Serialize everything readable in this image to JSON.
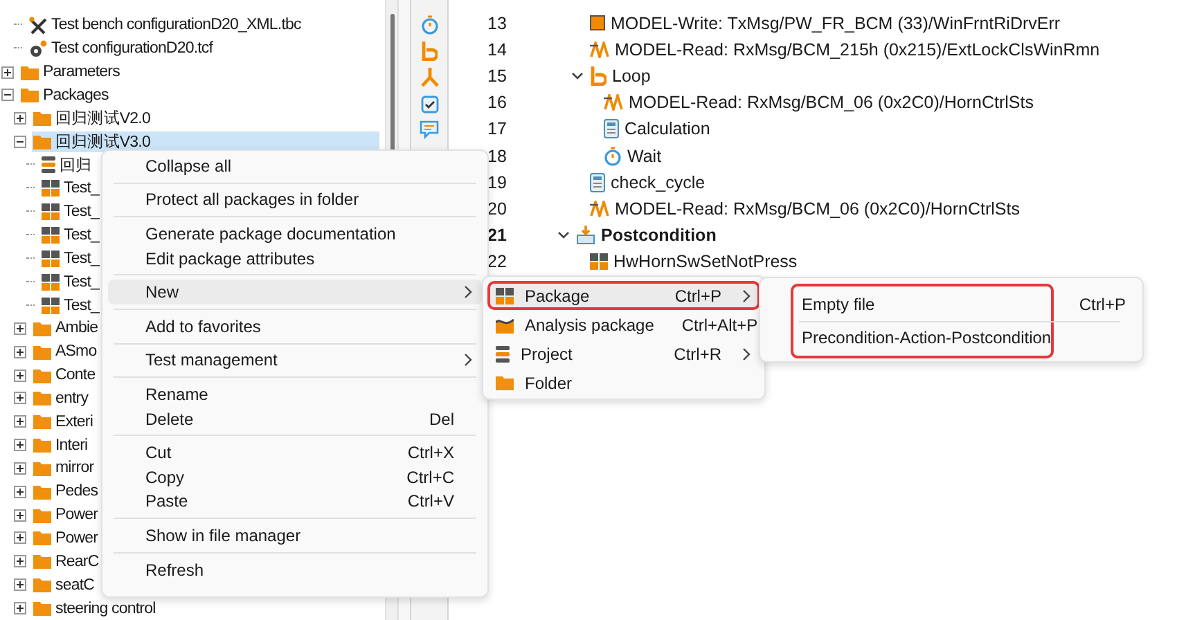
{
  "tree": [
    {
      "children": [
        {
          "label": "Test bench configurationD20_XML.tbc",
          "kind": "tool",
          "selected": false
        },
        {
          "label": "Test configurationD20.tcf",
          "kind": "gear",
          "selected": false
        }
      ]
    },
    {
      "label": "Parameters",
      "kind": "folder",
      "expanded": false,
      "selected": false
    },
    {
      "label": "Packages",
      "kind": "folder",
      "expanded": true,
      "selected": false,
      "children": [
        {
          "label": "回归测试V2.0",
          "kind": "folder",
          "expanded": false,
          "selected": false
        },
        {
          "label": "回归测试V3.0",
          "kind": "folder",
          "expanded": true,
          "selected": true,
          "children": [
            {
              "label": "回归",
              "kind": "project",
              "selected": false
            },
            {
              "label": "Test_",
              "kind": "package",
              "selected": false
            },
            {
              "label": "Test_",
              "kind": "package",
              "selected": false
            },
            {
              "label": "Test_",
              "kind": "package",
              "selected": false
            },
            {
              "label": "Test_",
              "kind": "package",
              "selected": false
            },
            {
              "label": "Test_",
              "kind": "package",
              "selected": false
            },
            {
              "label": "Test_",
              "kind": "package",
              "selected": false
            }
          ]
        },
        {
          "label": "Ambie",
          "kind": "folder",
          "expanded": false,
          "selected": false
        },
        {
          "label": "ASmo",
          "kind": "folder",
          "expanded": false,
          "selected": false
        },
        {
          "label": "Conte",
          "kind": "folder",
          "expanded": false,
          "selected": false
        },
        {
          "label": "entry",
          "kind": "folder",
          "expanded": false,
          "selected": false
        },
        {
          "label": "Exteri",
          "kind": "folder",
          "expanded": false,
          "selected": false
        },
        {
          "label": "Interi",
          "kind": "folder",
          "expanded": false,
          "selected": false
        },
        {
          "label": "mirror",
          "kind": "folder",
          "expanded": false,
          "selected": false
        },
        {
          "label": "Pedes",
          "kind": "folder",
          "expanded": false,
          "selected": false
        },
        {
          "label": "Power",
          "kind": "folder",
          "expanded": false,
          "selected": false
        },
        {
          "label": "Power",
          "kind": "folder",
          "expanded": false,
          "selected": false
        },
        {
          "label": "RearC",
          "kind": "folder",
          "expanded": false,
          "selected": false
        },
        {
          "label": "seatC",
          "kind": "folder",
          "expanded": false,
          "selected": false
        },
        {
          "label": "steering control",
          "kind": "folder",
          "expanded": false,
          "selected": false
        }
      ]
    }
  ],
  "toolbar": [
    {
      "kind": "stopwatch"
    },
    {
      "kind": "loop"
    },
    {
      "kind": "fork"
    },
    {
      "kind": "check"
    },
    {
      "kind": "comment"
    }
  ],
  "editor": [
    {
      "children": [
        {
          "line": "13",
          "label": "MODEL-Write: TxMsg/PW_FR_BCM (33)/WinFrntRiDrvErr",
          "kind": "write",
          "selected": false
        },
        {
          "line": "14",
          "label": "MODEL-Read: RxMsg/BCM_215h (0x215)/ExtLockClsWinRmn",
          "kind": "read",
          "selected": false
        },
        {
          "line": "15",
          "label": "Loop",
          "kind": "loop",
          "expanded": true,
          "selected": false,
          "children": [
            {
              "line": "16",
              "label": "MODEL-Read: RxMsg/BCM_06 (0x2C0)/HornCtrlSts",
              "kind": "read",
              "selected": false
            },
            {
              "line": "17",
              "label": "Calculation",
              "kind": "calc",
              "selected": false
            },
            {
              "line": "18",
              "label": "Wait",
              "kind": "wait",
              "selected": false
            }
          ]
        },
        {
          "line": "19",
          "label": "check_cycle",
          "kind": "calc",
          "selected": false
        },
        {
          "line": "20",
          "label": "MODEL-Read: RxMsg/BCM_06 (0x2C0)/HornCtrlSts",
          "kind": "read",
          "selected": false
        }
      ]
    },
    {
      "line": "21",
      "label": "Postcondition",
      "kind": "section",
      "expanded": true,
      "selected": true,
      "children": [
        {
          "line": "22",
          "label": "HwHornSwSetNotPress",
          "kind": "package",
          "selected": false
        }
      ]
    }
  ],
  "context_menu": {
    "groups": [
      [
        {
          "label": "Collapse all",
          "highlighted": false
        }
      ],
      [
        {
          "label": "Protect all packages in folder",
          "highlighted": false
        }
      ],
      [
        {
          "label": "Generate package documentation",
          "highlighted": false
        },
        {
          "label": "Edit package attributes",
          "highlighted": false
        }
      ],
      [
        {
          "label": "New",
          "submenu": true,
          "highlighted": true
        }
      ],
      [
        {
          "label": "Add to favorites",
          "highlighted": false
        }
      ],
      [
        {
          "label": "Test management",
          "submenu": true,
          "highlighted": false
        }
      ],
      [
        {
          "label": "Rename",
          "highlighted": false
        },
        {
          "label": "Delete",
          "shortcut": "Del",
          "highlighted": false
        }
      ],
      [
        {
          "label": "Cut",
          "shortcut": "Ctrl+X",
          "highlighted": false
        },
        {
          "label": "Copy",
          "shortcut": "Ctrl+C",
          "highlighted": false
        },
        {
          "label": "Paste",
          "shortcut": "Ctrl+V",
          "highlighted": false
        }
      ],
      [
        {
          "label": "Show in file manager",
          "highlighted": false
        }
      ],
      [
        {
          "label": "Refresh",
          "highlighted": false
        }
      ]
    ]
  },
  "new_submenu": {
    "items": [
      {
        "label": "Package",
        "kind": "package",
        "shortcut": "Ctrl+P",
        "submenu": true,
        "highlighted": true,
        "outlined": true
      },
      {
        "label": "Analysis package",
        "kind": "analysis",
        "shortcut": "Ctrl+Alt+P",
        "highlighted": false,
        "outlined": false
      },
      {
        "label": "Project",
        "kind": "project",
        "shortcut": "Ctrl+R",
        "submenu": true,
        "highlighted": false,
        "outlined": false
      },
      {
        "label": "Folder",
        "kind": "folder",
        "highlighted": false,
        "outlined": false
      }
    ]
  },
  "package_submenu": {
    "outlined": true,
    "groups": [
      [
        {
          "label": "Empty file",
          "shortcut": "Ctrl+P"
        }
      ],
      [
        {
          "label": "Precondition-Action-Postcondition"
        }
      ]
    ]
  }
}
